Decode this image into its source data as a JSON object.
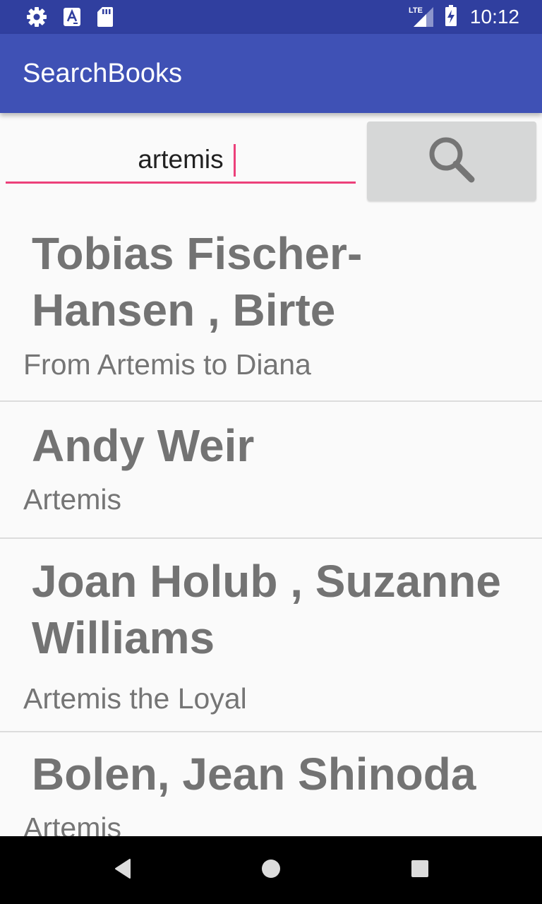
{
  "status_bar": {
    "time": "10:12",
    "network": "LTE",
    "icons": [
      "settings-icon",
      "text-a-icon",
      "sd-card-icon",
      "lte-signal-icon",
      "battery-charging-icon"
    ]
  },
  "app_bar": {
    "title": "SearchBooks"
  },
  "search": {
    "value": "artemis",
    "button_icon": "search-icon"
  },
  "results": [
    {
      "author": "Tobias Fischer-Hansen , Birte",
      "title": "From Artemis to Diana"
    },
    {
      "author": "Andy Weir",
      "title": "Artemis"
    },
    {
      "author": "Joan Holub , Suzanne Williams",
      "title": "Artemis the Loyal"
    },
    {
      "author": "Bolen, Jean Shinoda",
      "title": "Artemis"
    }
  ],
  "nav_bar": {
    "icons": [
      "back-icon",
      "home-icon",
      "recents-icon"
    ]
  },
  "colors": {
    "status_bar": "#303f9f",
    "app_bar": "#3f51b5",
    "accent": "#ec407a",
    "button": "#d6d7d7",
    "text_secondary": "#757575"
  }
}
